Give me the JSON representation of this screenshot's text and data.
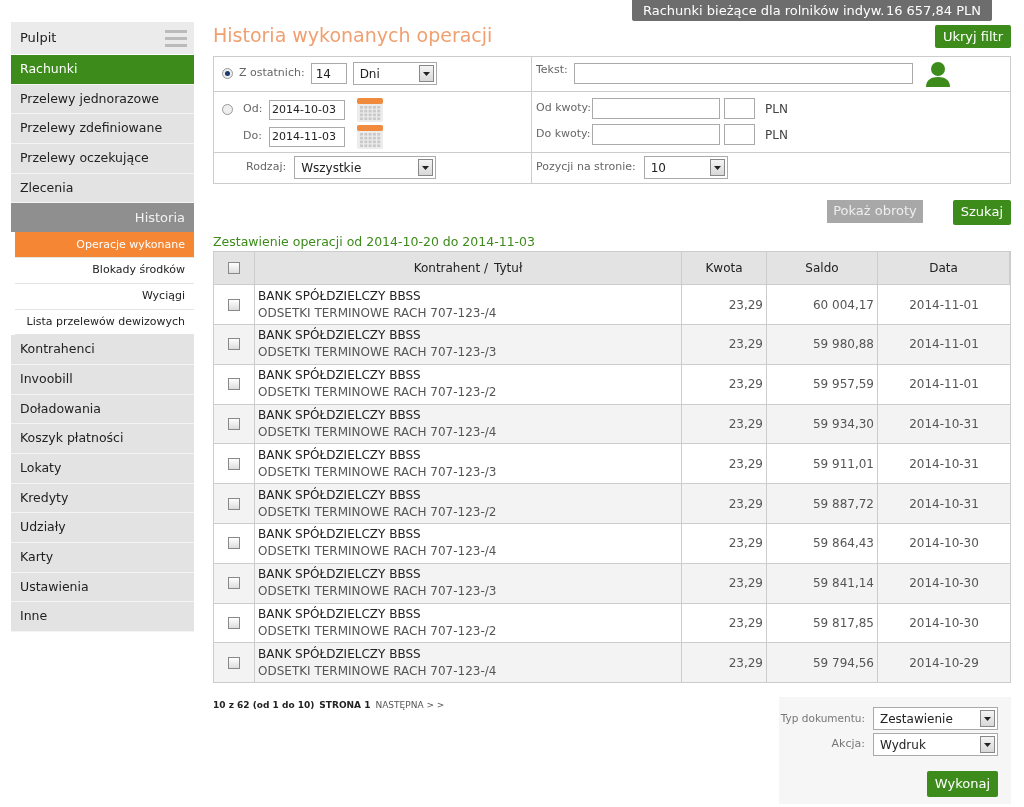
{
  "account_bar": {
    "name": "Rachunki bieżące dla rolników indyw.",
    "balance": "16 657,84 PLN"
  },
  "sidebar": {
    "items": [
      {
        "label": "Pulpit",
        "kind": "top",
        "selected": false
      },
      {
        "label": "Rachunki",
        "kind": "main",
        "selected": true
      },
      {
        "label": "Przelewy jednorazowe",
        "kind": "main",
        "selected": false
      },
      {
        "label": "Przelewy zdefiniowane",
        "kind": "main",
        "selected": false
      },
      {
        "label": "Przelewy oczekujące",
        "kind": "main",
        "selected": false
      },
      {
        "label": "Zlecenia",
        "kind": "main",
        "selected": false
      },
      {
        "label": "Historia",
        "kind": "section",
        "selected": false,
        "expanded": true,
        "children": [
          {
            "label": "Operacje wykonane",
            "selected": true
          },
          {
            "label": "Blokady środków",
            "selected": false
          },
          {
            "label": "Wyciągi",
            "selected": false
          },
          {
            "label": "Lista przelewów dewizowych",
            "selected": false
          }
        ]
      },
      {
        "label": "Kontrahenci",
        "kind": "main",
        "selected": false
      },
      {
        "label": "Invoobill",
        "kind": "main",
        "selected": false
      },
      {
        "label": "Doładowania",
        "kind": "main",
        "selected": false
      },
      {
        "label": "Koszyk płatności",
        "kind": "main",
        "selected": false
      },
      {
        "label": "Lokaty",
        "kind": "main",
        "selected": false
      },
      {
        "label": "Kredyty",
        "kind": "main",
        "selected": false
      },
      {
        "label": "Udziały",
        "kind": "main",
        "selected": false
      },
      {
        "label": "Karty",
        "kind": "main",
        "selected": false
      },
      {
        "label": "Ustawienia",
        "kind": "main",
        "selected": false
      },
      {
        "label": "Inne",
        "kind": "main",
        "selected": false
      }
    ]
  },
  "page_title": "Historia wykonanych operacji",
  "hide_filter_button": "Ukryj filtr",
  "filter": {
    "recent": {
      "selected": true,
      "label": "Z ostatnich:",
      "value": "14",
      "unit": "Dni"
    },
    "range": {
      "selected": false,
      "from_label": "Od:",
      "from": "2014-10-03",
      "to_label": "Do:",
      "to": "2014-11-03"
    },
    "type": {
      "label": "Rodzaj:",
      "value": "Wszystkie"
    },
    "text": {
      "label": "Tekst:"
    },
    "amount_from": {
      "label": "Od kwoty:",
      "currency": "PLN"
    },
    "amount_to": {
      "label": "Do kwoty:",
      "currency": "PLN"
    },
    "per_page": {
      "label": "Pozycji na stronie:",
      "value": "10"
    }
  },
  "show_turnover_button": "Pokaż obroty",
  "search_button": "Szukaj",
  "summary": "Zestawienie operacji od 2014-10-20 do 2014-11-03",
  "table": {
    "select_all_checked": false,
    "columns": [
      "Kontrahent /",
      "Tytuł",
      "Kwota",
      "Saldo",
      "Data"
    ],
    "rows": [
      {
        "checked": false,
        "party": "BANK SPÓŁDZIELCZY BBSS",
        "title": "ODSETKI TERMINOWE RACH 707-123-/4",
        "amount": "23,29",
        "balance": "60 004,17",
        "date": "2014-11-01"
      },
      {
        "checked": false,
        "party": "BANK SPÓŁDZIELCZY BBSS",
        "title": "ODSETKI TERMINOWE RACH 707-123-/3",
        "amount": "23,29",
        "balance": "59 980,88",
        "date": "2014-11-01"
      },
      {
        "checked": false,
        "party": "BANK SPÓŁDZIELCZY BBSS",
        "title": "ODSETKI TERMINOWE RACH 707-123-/2",
        "amount": "23,29",
        "balance": "59 957,59",
        "date": "2014-11-01"
      },
      {
        "checked": false,
        "party": "BANK SPÓŁDZIELCZY BBSS",
        "title": "ODSETKI TERMINOWE RACH 707-123-/4",
        "amount": "23,29",
        "balance": "59 934,30",
        "date": "2014-10-31"
      },
      {
        "checked": false,
        "party": "BANK SPÓŁDZIELCZY BBSS",
        "title": "ODSETKI TERMINOWE RACH 707-123-/3",
        "amount": "23,29",
        "balance": "59 911,01",
        "date": "2014-10-31"
      },
      {
        "checked": false,
        "party": "BANK SPÓŁDZIELCZY BBSS",
        "title": "ODSETKI TERMINOWE RACH 707-123-/2",
        "amount": "23,29",
        "balance": "59 887,72",
        "date": "2014-10-31"
      },
      {
        "checked": false,
        "party": "BANK SPÓŁDZIELCZY BBSS",
        "title": "ODSETKI TERMINOWE RACH 707-123-/4",
        "amount": "23,29",
        "balance": "59 864,43",
        "date": "2014-10-30"
      },
      {
        "checked": false,
        "party": "BANK SPÓŁDZIELCZY BBSS",
        "title": "ODSETKI TERMINOWE RACH 707-123-/3",
        "amount": "23,29",
        "balance": "59 841,14",
        "date": "2014-10-30"
      },
      {
        "checked": false,
        "party": "BANK SPÓŁDZIELCZY BBSS",
        "title": "ODSETKI TERMINOWE RACH 707-123-/2",
        "amount": "23,29",
        "balance": "59 817,85",
        "date": "2014-10-30"
      },
      {
        "checked": false,
        "party": "BANK SPÓŁDZIELCZY BBSS",
        "title": "ODSETKI TERMINOWE RACH 707-123-/4",
        "amount": "23,29",
        "balance": "59 794,56",
        "date": "2014-10-29"
      }
    ]
  },
  "pagination": {
    "count": "10 z 62 (od 1 do 10)",
    "page": "STRONA 1",
    "next": "NASTĘPNA > >"
  },
  "export": {
    "doc_type_label": "Typ dokumentu:",
    "doc_type": "Zestawienie",
    "action_label": "Akcja:",
    "action": "Wydruk",
    "button": "Wykonaj"
  }
}
